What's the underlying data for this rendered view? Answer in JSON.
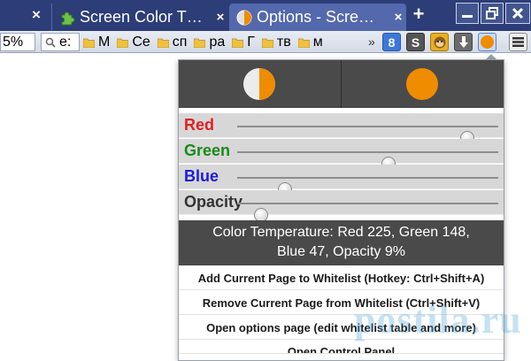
{
  "tabs": [
    {
      "title": "",
      "close": "×",
      "active": false
    },
    {
      "title": "Screen Color T…",
      "close": "×",
      "active": false
    },
    {
      "title": "Options - Scre…",
      "close": "×",
      "active": true
    }
  ],
  "new_tab_label": "+",
  "toolbar": {
    "zoom": "5%",
    "url_fragment": "e:",
    "bookmarks": [
      "М",
      "Се",
      "сп",
      "ра",
      "Г",
      "тв",
      "м"
    ],
    "more": "»",
    "ext_labels": {
      "g": "8",
      "s": "S"
    }
  },
  "popup": {
    "sliders": [
      {
        "label": "Red",
        "color": "#e02020",
        "value": 225,
        "max": 255
      },
      {
        "label": "Green",
        "color": "#1a8a1a",
        "value": 148,
        "max": 255
      },
      {
        "label": "Blue",
        "color": "#1c1cd8",
        "value": 47,
        "max": 255
      },
      {
        "label": "Opacity",
        "color": "#333333",
        "value": 9,
        "max": 100
      }
    ],
    "status_line1": "Color Temperature: Red 225, Green 148,",
    "status_line2": "Blue 47, Opacity 9%",
    "menu": [
      "Add Current Page to Whitelist (Hotkey: Ctrl+Shift+A)",
      "Remove Current Page from Whitelist (Ctrl+Shift+V)",
      "Open options page (edit whitelist table and more)",
      "Open Control Panel"
    ]
  },
  "colors": {
    "accent": "#f08c00",
    "tabstrip": "#2d3d78",
    "active_tab": "#5468ad",
    "popup_dark": "#4a4a4a"
  },
  "watermark": "postila.ru"
}
